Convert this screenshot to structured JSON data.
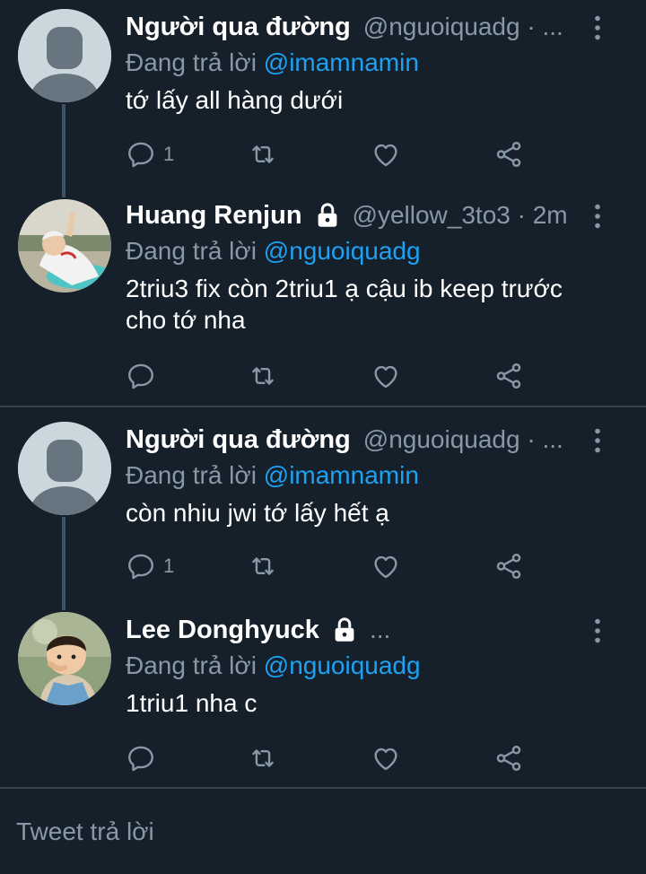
{
  "colors": {
    "background": "#15202b",
    "accent": "#1da1f2",
    "secondary_text": "#8899a6",
    "divider": "#38444d"
  },
  "tweets": [
    {
      "name": "Người qua đường",
      "handle": "@nguoiquadg · ...",
      "reply_prefix": "Đang trả lời ",
      "reply_mention": "@imamnamin",
      "text": "tớ lấy all hàng dưới",
      "reply_count": "1",
      "avatar": "default-avatar",
      "protected": false
    },
    {
      "name": "Huang Renjun",
      "handle": "@yellow_3to3 · 2m",
      "reply_prefix": "Đang trả lời ",
      "reply_mention": "@nguoiquadg",
      "text": "2triu3 fix còn 2triu1 ạ cậu ib keep trước cho tớ nha",
      "reply_count": "",
      "avatar": "photo-avatar",
      "protected": true
    },
    {
      "name": "Người qua đường",
      "handle": "@nguoiquadg · ...",
      "reply_prefix": "Đang trả lời ",
      "reply_mention": "@imamnamin",
      "text": "còn nhiu jwi tớ lấy hết ạ",
      "reply_count": "1",
      "avatar": "default-avatar",
      "protected": false
    },
    {
      "name": "Lee Donghyuck",
      "handle": "...",
      "reply_prefix": "Đang trả lời ",
      "reply_mention": "@nguoiquadg",
      "text": "1triu1 nha c",
      "reply_count": "",
      "avatar": "photo-avatar",
      "protected": true
    }
  ],
  "icons": [
    "reply-icon",
    "retweet-icon",
    "like-icon",
    "share-icon",
    "more-icon",
    "lock-icon"
  ],
  "composer": {
    "placeholder": "Tweet trả lời"
  }
}
